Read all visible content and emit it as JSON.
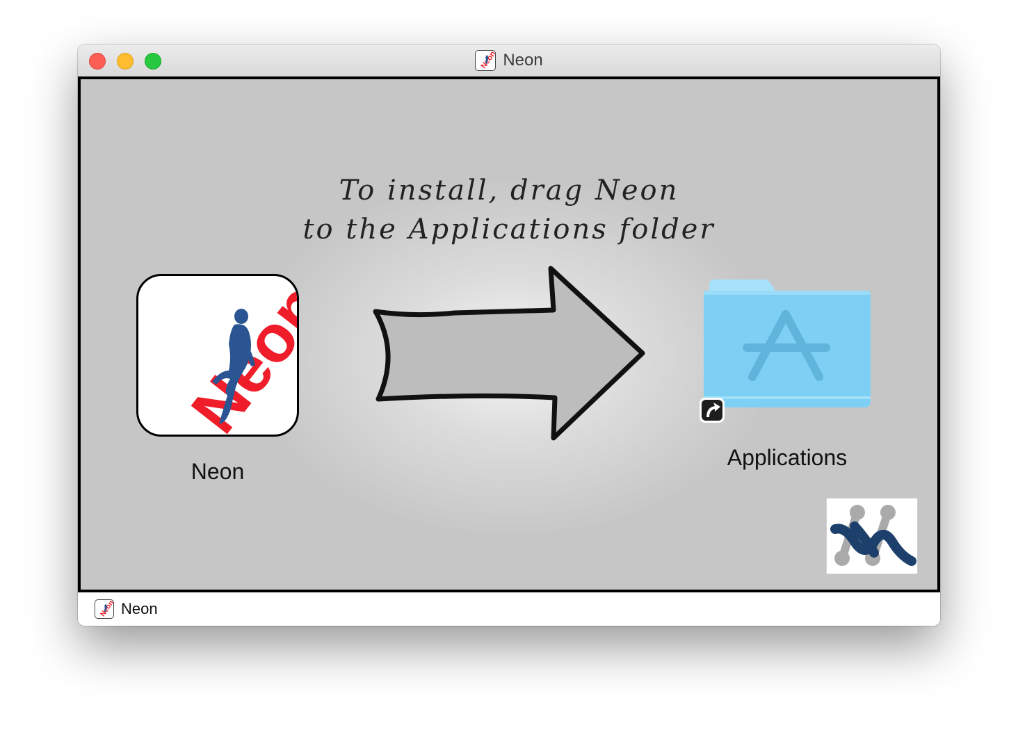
{
  "window": {
    "title": "Neon",
    "traffic_lights": [
      "close",
      "minimize",
      "zoom"
    ]
  },
  "installer": {
    "instruction_line1": "To install, drag Neon",
    "instruction_line2": "to the Applications folder",
    "app_icon_label": "Neon",
    "app_icon_text": "Neon",
    "folder_label": "Applications",
    "arrow_icon": "drag-arrow-icon",
    "folder_icon": "applications-folder-icon",
    "alias_icon": "alias-arrow-icon",
    "corner_logo": "vendor-logo"
  },
  "statusbar": {
    "label": "Neon"
  },
  "colors": {
    "neon_red": "#ef1c2a",
    "figure_blue": "#2a5592",
    "folder_blue": "#7dcff3",
    "logo_navy": "#1d3f6b"
  }
}
